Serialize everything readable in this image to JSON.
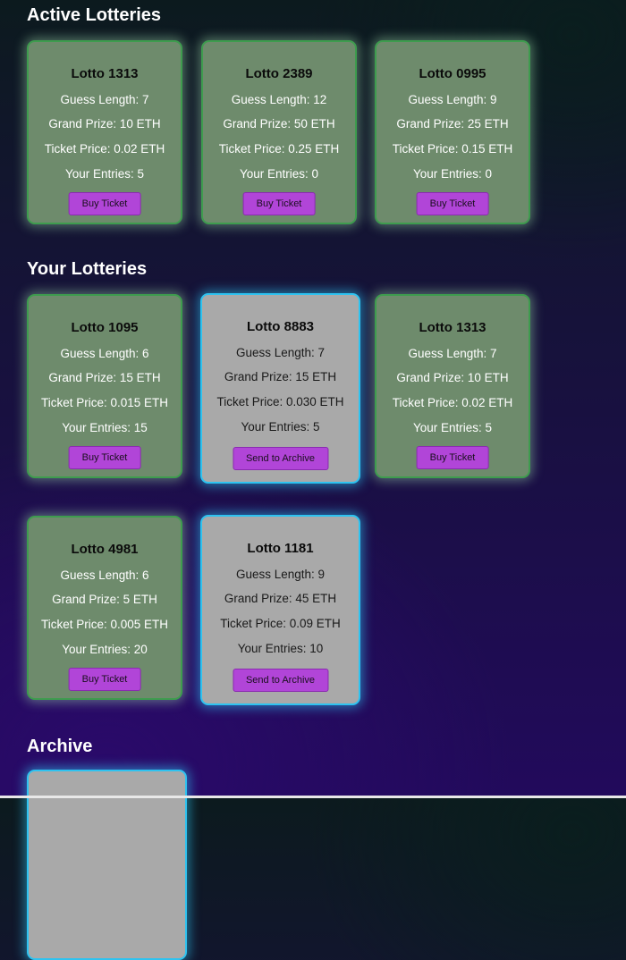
{
  "sections": {
    "active": "Active Lotteries",
    "yours": "Your Lotteries",
    "archive": "Archive"
  },
  "active_lotteries": [
    {
      "name": "Lotto 1313",
      "guess": "Guess Length: 7",
      "prize": "Grand Prize: 10 ETH",
      "price": "Ticket Price: 0.02 ETH",
      "entries": "Your Entries: 5",
      "button": "Buy Ticket"
    },
    {
      "name": "Lotto 2389",
      "guess": "Guess Length: 12",
      "prize": "Grand Prize: 50 ETH",
      "price": "Ticket Price: 0.25 ETH",
      "entries": "Your Entries: 0",
      "button": "Buy Ticket"
    },
    {
      "name": "Lotto 0995",
      "guess": "Guess Length: 9",
      "prize": "Grand Prize: 25 ETH",
      "price": "Ticket Price: 0.15 ETH",
      "entries": "Your Entries: 0",
      "button": "Buy Ticket"
    }
  ],
  "your_lotteries": [
    {
      "name": "Lotto 1095",
      "guess": "Guess Length: 6",
      "prize": "Grand Prize: 15 ETH",
      "price": "Ticket Price: 0.015 ETH",
      "entries": "Your Entries: 15",
      "button": "Buy Ticket"
    },
    {
      "name": "Lotto 8883",
      "guess": "Guess Length: 7",
      "prize": "Grand Prize: 15 ETH",
      "price": "Ticket Price: 0.030 ETH",
      "entries": "Your Entries: 5",
      "button": "Send to Archive"
    },
    {
      "name": "Lotto 1313",
      "guess": "Guess Length: 7",
      "prize": "Grand Prize: 10 ETH",
      "price": "Ticket Price: 0.02 ETH",
      "entries": "Your Entries: 5",
      "button": "Buy Ticket"
    },
    {
      "name": "Lotto 4981",
      "guess": "Guess Length: 6",
      "prize": "Grand Prize: 5 ETH",
      "price": "Ticket Price: 0.005 ETH",
      "entries": "Your Entries: 20",
      "button": "Buy Ticket"
    },
    {
      "name": "Lotto 1181",
      "guess": "Guess Length: 9",
      "prize": "Grand Prize: 45 ETH",
      "price": "Ticket Price: 0.09 ETH",
      "entries": "Your Entries: 10",
      "button": "Send to Archive"
    }
  ],
  "colors": {
    "card_open": "#6e8b6c",
    "card_ended": "#a9a9a9",
    "button": "#b145d8",
    "ended_border": "#2ec3f0"
  }
}
